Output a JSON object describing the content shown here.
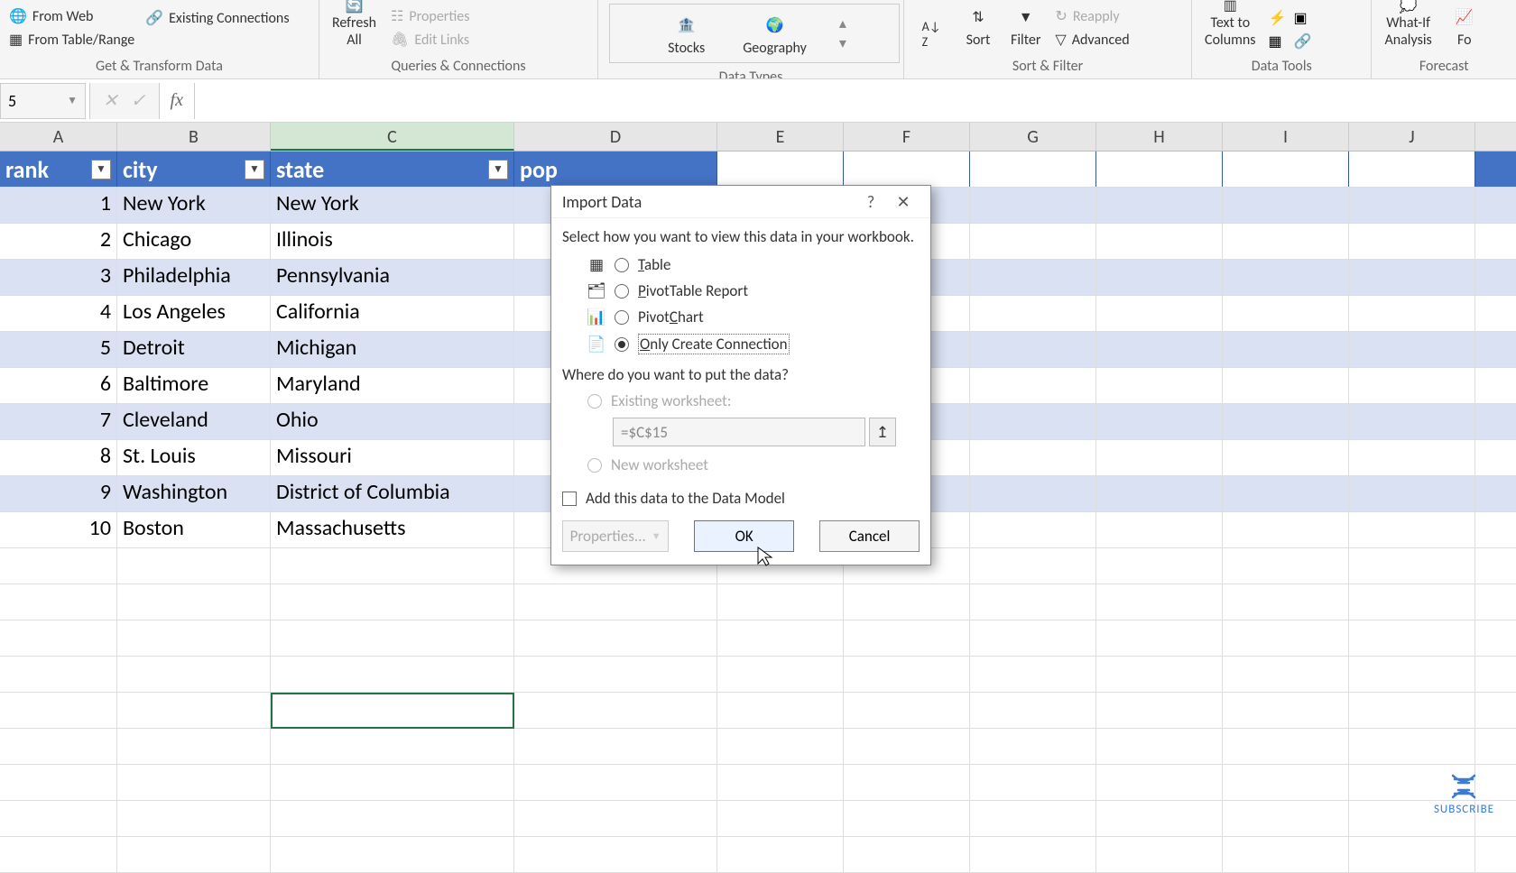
{
  "ribbon": {
    "get_transform": {
      "from_web": "From Web",
      "from_table": "From Table/Range",
      "existing_conn": "Existing Connections",
      "label": "Get & Transform Data"
    },
    "queries": {
      "refresh_all": "Refresh\nAll",
      "properties": "Properties",
      "edit_links": "Edit Links",
      "label": "Queries & Connections"
    },
    "data_types": {
      "stocks": "Stocks",
      "geography": "Geography",
      "label": "Data Types"
    },
    "sort_filter": {
      "sort": "Sort",
      "filter": "Filter",
      "reapply": "Reapply",
      "advanced": "Advanced",
      "label": "Sort & Filter"
    },
    "data_tools": {
      "text_to_columns": "Text to\nColumns",
      "label": "Data Tools"
    },
    "forecast": {
      "what_if": "What-If\nAnalysis",
      "fo": "Fo",
      "label": "Forecast"
    }
  },
  "namebox": "5",
  "columns": [
    "A",
    "B",
    "C",
    "D",
    "E",
    "F",
    "G",
    "H",
    "I",
    "J"
  ],
  "table": {
    "headers": [
      "rank",
      "city",
      "state",
      "pop"
    ],
    "rows": [
      {
        "rank": "1",
        "city": "New York",
        "state": "New York"
      },
      {
        "rank": "2",
        "city": "Chicago",
        "state": "Illinois"
      },
      {
        "rank": "3",
        "city": "Philadelphia",
        "state": "Pennsylvania"
      },
      {
        "rank": "4",
        "city": "Los Angeles",
        "state": "California"
      },
      {
        "rank": "5",
        "city": "Detroit",
        "state": "Michigan"
      },
      {
        "rank": "6",
        "city": "Baltimore",
        "state": "Maryland"
      },
      {
        "rank": "7",
        "city": "Cleveland",
        "state": "Ohio"
      },
      {
        "rank": "8",
        "city": "St. Louis",
        "state": "Missouri"
      },
      {
        "rank": "9",
        "city": "Washington",
        "state": "District of Columbia"
      },
      {
        "rank": "10",
        "city": "Boston",
        "state": "Massachusetts"
      }
    ]
  },
  "dialog": {
    "title": "Import Data",
    "prompt1": "Select how you want to view this data in your workbook.",
    "opt_table": "able",
    "opt_pivot_table": "ivotTable Report",
    "opt_pivot_chart": "Pivot",
    "opt_pivot_chart2": "hart",
    "opt_only_conn": "nly Create Connection",
    "prompt2": "Where do you want to put the data?",
    "existing_ws": "Existing worksheet:",
    "ref_value": "=$C$15",
    "new_ws": "New worksheet",
    "add_data_model_pre": "Add this data to the Data ",
    "add_data_model_m": "M",
    "add_data_model_post": "odel",
    "properties": "Properties...",
    "ok": "OK",
    "cancel": "Cancel"
  },
  "subscribe": "SUBSCRIBE"
}
